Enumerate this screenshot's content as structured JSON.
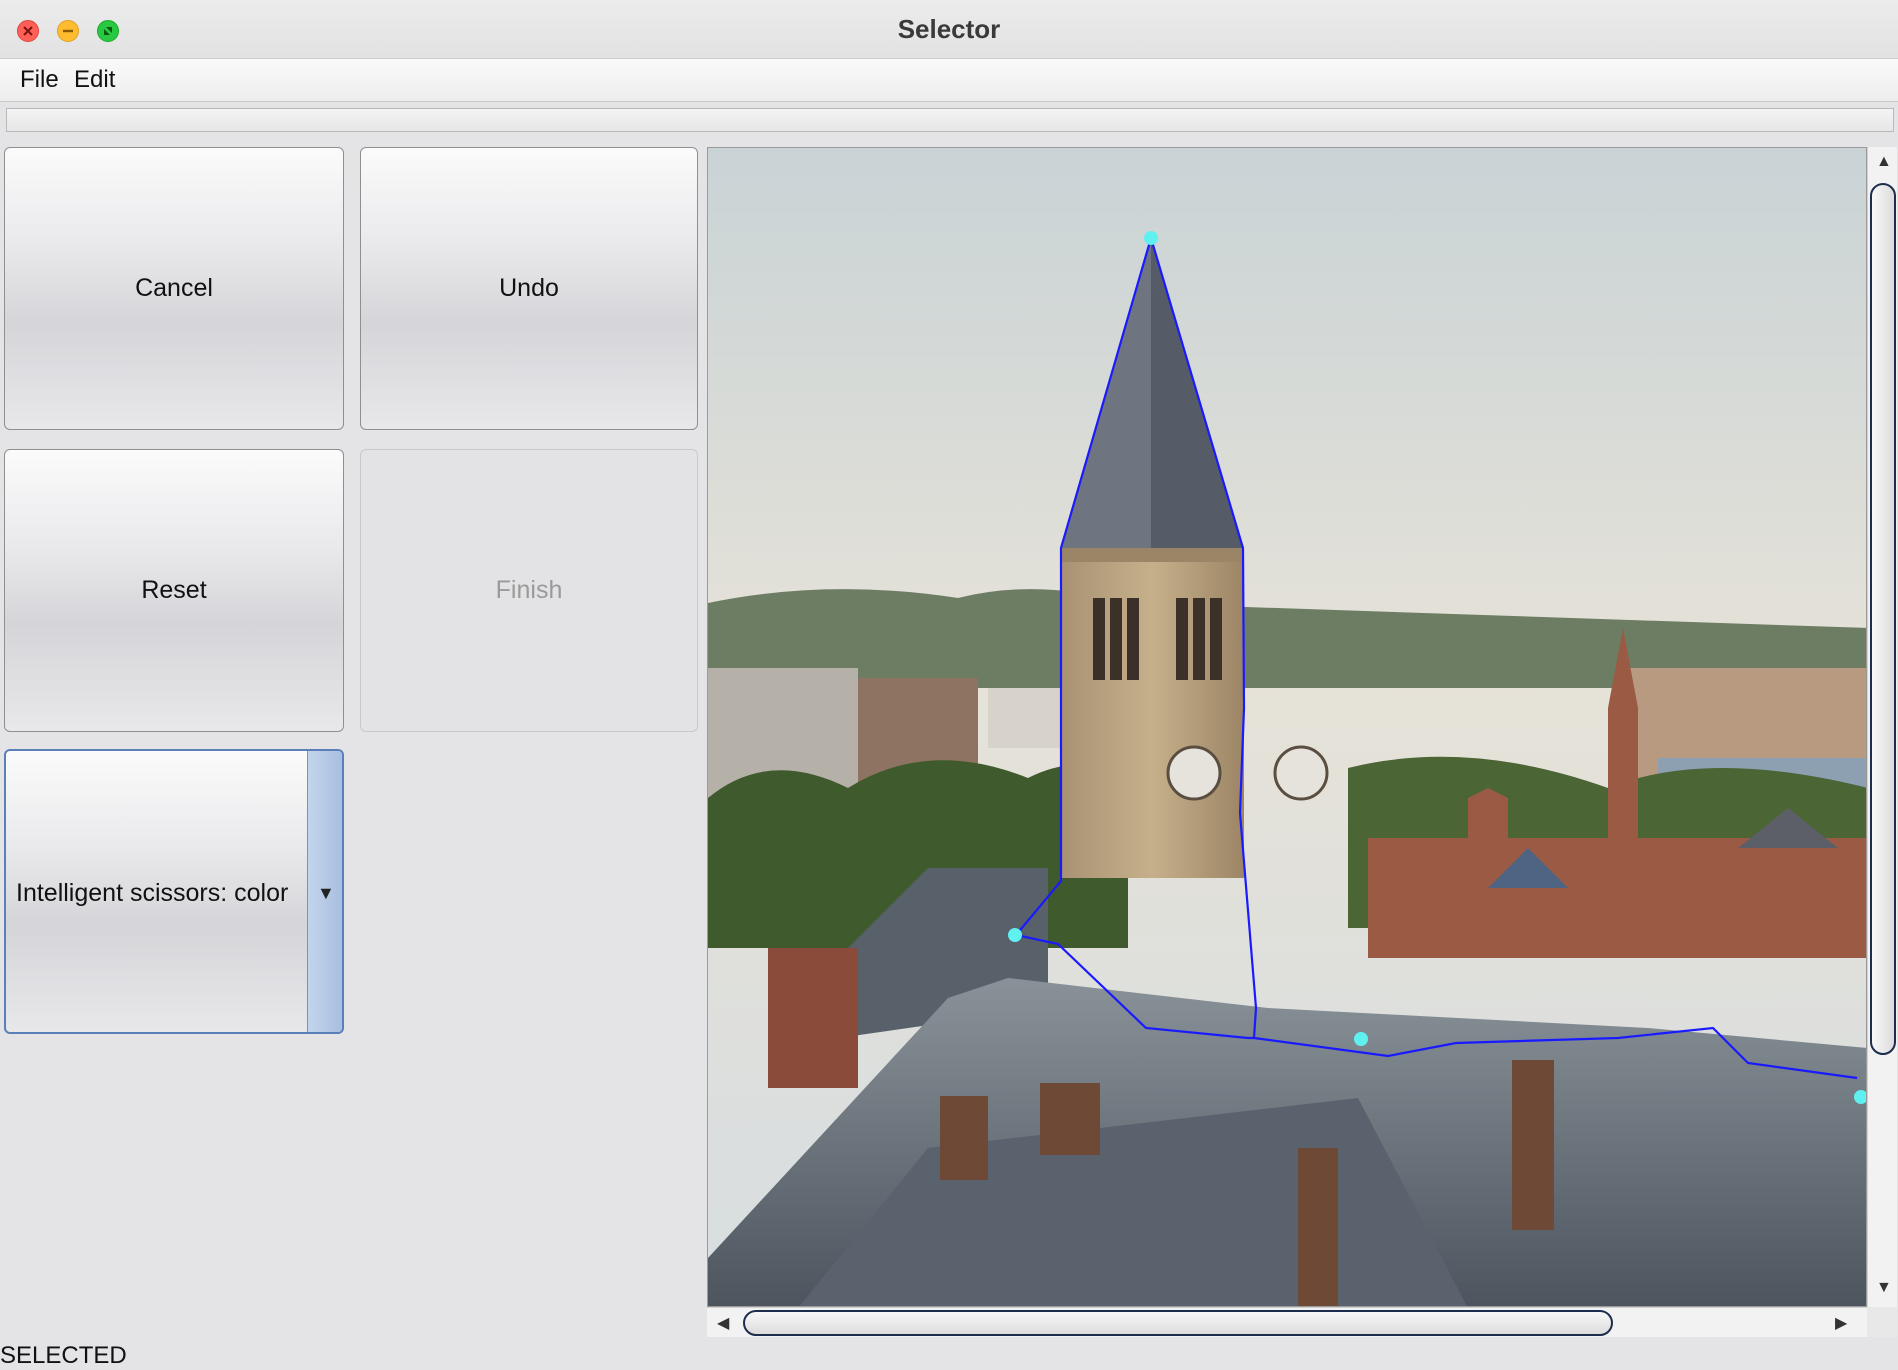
{
  "window": {
    "title": "Selector"
  },
  "menu": {
    "file": "File",
    "edit": "Edit"
  },
  "buttons": {
    "cancel": "Cancel",
    "undo": "Undo",
    "reset": "Reset",
    "finish": "Finish"
  },
  "tool_select": {
    "value": "Intelligent scissors: color"
  },
  "status": {
    "text": "SELECTED"
  },
  "colors": {
    "selection_path": "#1a1aff",
    "control_point": "#5ff0f0",
    "dropdown_focus": "#5b7fb8"
  },
  "icons": {
    "close": "close-icon",
    "minimize": "minimize-icon",
    "zoom": "zoom-icon",
    "dropdown": "chevron-down-icon",
    "scroll_up": "arrow-up-icon",
    "scroll_down": "arrow-down-icon",
    "scroll_left": "arrow-left-icon",
    "scroll_right": "arrow-right-icon"
  }
}
